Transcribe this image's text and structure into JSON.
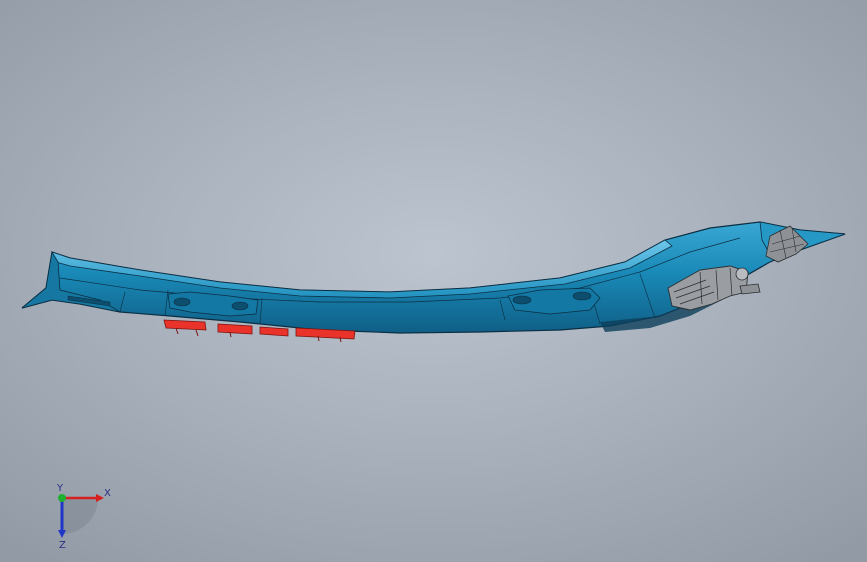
{
  "viewport": {
    "background_colors": [
      "#bcc4cf",
      "#aab2be",
      "#929aa6"
    ]
  },
  "model": {
    "body_color": "#1a8ab8",
    "edge_color": "#0b2f44",
    "highlight_color": "#4fb8df",
    "clip_color": "#e8322a",
    "bracket_color": "#9a9da1"
  },
  "triad": {
    "x_label": "X",
    "y_label": "Y",
    "z_label": "Z",
    "x_color": "#d62020",
    "y_color": "#1fb030",
    "z_color": "#1f36c8"
  }
}
